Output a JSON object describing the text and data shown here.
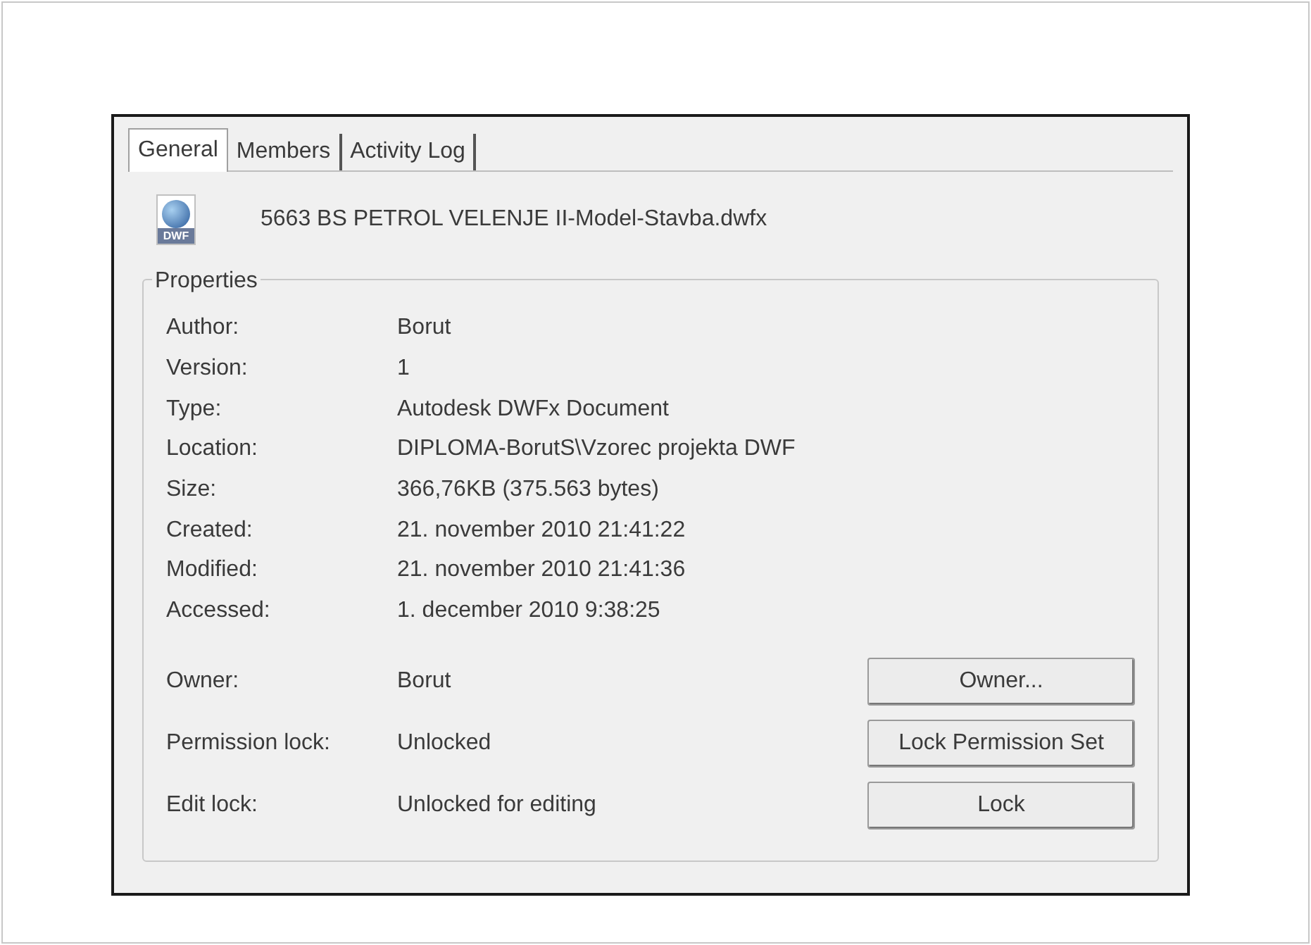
{
  "tabs": [
    {
      "label": "General",
      "selected": true
    },
    {
      "label": "Members",
      "selected": false
    },
    {
      "label": "Activity Log",
      "selected": false
    }
  ],
  "file": {
    "icon_label": "DWF",
    "name": "5663 BS PETROL VELENJE II-Model-Stavba.dwfx"
  },
  "properties": {
    "title": "Properties",
    "rows": [
      {
        "label": "Author:",
        "value": "Borut"
      },
      {
        "label": "Version:",
        "value": "1"
      },
      {
        "label": "Type:",
        "value": "Autodesk DWFx Document"
      },
      {
        "label": "Location:",
        "value": "DIPLOMA-BorutS\\Vzorec projekta DWF"
      },
      {
        "label": "Size:",
        "value": "366,76KB (375.563 bytes)"
      },
      {
        "label": "Created:",
        "value": "21. november 2010  21:41:22"
      },
      {
        "label": "Modified:",
        "value": "21. november 2010  21:41:36"
      },
      {
        "label": "Accessed:",
        "value": "1. december 2010  9:38:25"
      }
    ],
    "action_rows": [
      {
        "label": "Owner:",
        "value": "Borut",
        "button": "Owner..."
      },
      {
        "label": "Permission lock:",
        "value": "Unlocked",
        "button": "Lock Permission Set"
      },
      {
        "label": "Edit lock:",
        "value": "Unlocked for editing",
        "button": "Lock"
      }
    ]
  }
}
